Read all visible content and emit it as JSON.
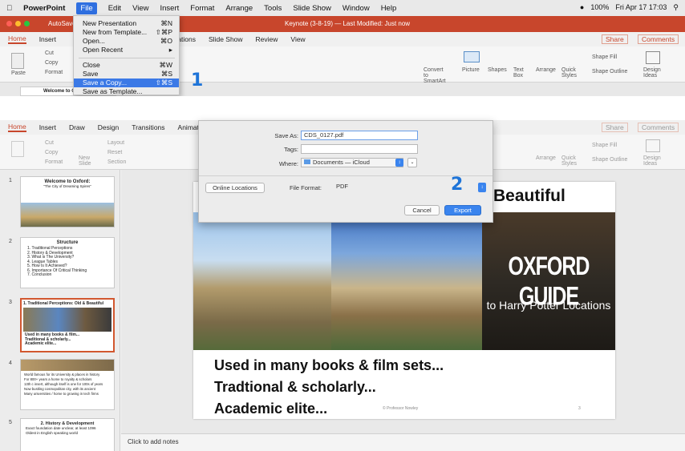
{
  "menubar": {
    "app_name": "PowerPoint",
    "items": [
      "File",
      "Edit",
      "View",
      "Insert",
      "Format",
      "Arrange",
      "Tools",
      "Slide Show",
      "Window",
      "Help"
    ],
    "status": "100%",
    "clock": "Fri Apr 17  17:03"
  },
  "window": {
    "title": "Keynote (3-8-19) — Last Modified: Just now",
    "autosave": "AutoSave"
  },
  "ribbon_tabs": [
    "Home",
    "Insert",
    "Draw",
    "Design",
    "Transitions",
    "Animations",
    "Slide Show",
    "Review",
    "View"
  ],
  "ribbon_buttons": {
    "share": "Share",
    "comments": "Comments",
    "paste": "Paste",
    "cut": "Cut",
    "copy": "Copy",
    "format": "Format",
    "new_slide": "New Slide",
    "layout": "Layout",
    "reset": "Reset",
    "section": "Section",
    "convert": "Convert to SmartArt",
    "picture": "Picture",
    "shapes": "Shapes",
    "textbox": "Text Box",
    "arrange": "Arrange",
    "quick_styles": "Quick Styles",
    "shape_fill": "Shape Fill",
    "shape_outline": "Shape Outline",
    "design_ideas": "Design Ideas"
  },
  "file_menu": {
    "items": [
      {
        "label": "New Presentation",
        "shortcut": "⌘N"
      },
      {
        "label": "New from Template...",
        "shortcut": "⇧⌘P"
      },
      {
        "label": "Open...",
        "shortcut": "⌘O"
      },
      {
        "label": "Open Recent",
        "shortcut": "▸"
      },
      {
        "label": "Close",
        "shortcut": "⌘W"
      },
      {
        "label": "Save",
        "shortcut": "⌘S"
      },
      {
        "label": "Save a Copy...",
        "shortcut": "⇧⌘S"
      },
      {
        "label": "Save as Template...",
        "shortcut": ""
      }
    ]
  },
  "step_markers": {
    "one": "1",
    "two": "2"
  },
  "save_dialog": {
    "save_as_label": "Save As:",
    "save_as_value": "CDS_0127.pdf",
    "tags_label": "Tags:",
    "where_label": "Where:",
    "where_value": "Documents — iCloud",
    "online_locations": "Online Locations",
    "file_format_label": "File Format:",
    "file_format_value": "PDF",
    "cancel": "Cancel",
    "export": "Export"
  },
  "thumbnails": [
    {
      "num": "1",
      "title": "Welcome to Oxford:",
      "subtitle": "\"The City of Dreaming Spires\""
    },
    {
      "num": "2",
      "title": "Structure",
      "lines": [
        "1. Traditional Perceptions",
        "2. History & Development",
        "3. What is The University?",
        "4. League Tables",
        "5. How Is It Achieved?",
        "6. Importance Of Critical Thinking",
        "7. Conclusion"
      ]
    },
    {
      "num": "3",
      "title": "1. Traditional Perceptions: Old & Beautiful",
      "lines": [
        "Used in many books & film...",
        "Traditional & scholarly...",
        "Academic elite..."
      ]
    },
    {
      "num": "4",
      "lines": [
        "World famous for its University & places in history",
        "For 800+ years a home to royalty & scholars",
        "13th c insert, although itself is one for 100s of years",
        "Now bustling cosmopolitan city, with its ancient",
        "Many universities / home to growing in tech firms"
      ]
    },
    {
      "num": "5",
      "title": "2. History & Development",
      "lines": [
        "Exact foundation date unclear, at least 1096",
        "Oldest in English speaking world"
      ]
    }
  ],
  "slide": {
    "title_fragment": "Beautiful",
    "guide_title": "OXFORD GUIDE",
    "guide_sub": "to Harry Potter Locations",
    "bullets": [
      "Used in many books & film sets...",
      "Tradtional & scholarly...",
      "Academic elite..."
    ],
    "footer": "© Professor Nowley",
    "page_num": "3"
  },
  "notes_placeholder": "Click to add notes",
  "colors": {
    "accent": "#c8462c",
    "highlight": "#3b79e6",
    "marker": "#1e74d8"
  }
}
